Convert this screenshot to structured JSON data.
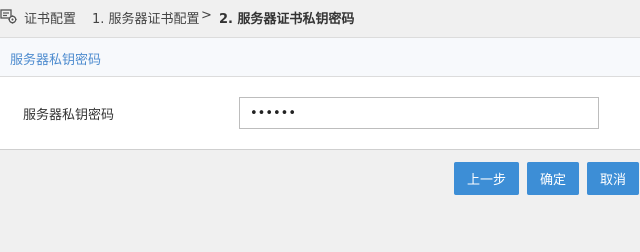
{
  "breadcrumb": {
    "root": "证书配置",
    "step1": "1. 服务器证书配置",
    "separator": ">",
    "step2": "2. 服务器证书私钥密码"
  },
  "panel": {
    "title": "服务器私钥密码"
  },
  "form": {
    "password_label": "服务器私钥密码",
    "password_value": "123456"
  },
  "buttons": {
    "prev": "上一步",
    "ok": "确定",
    "cancel": "取消"
  },
  "colors": {
    "accent": "#3d8ed6",
    "title_blue": "#4e8ccf"
  },
  "icons": {
    "breadcrumb_icon": "certificate-config-icon"
  }
}
